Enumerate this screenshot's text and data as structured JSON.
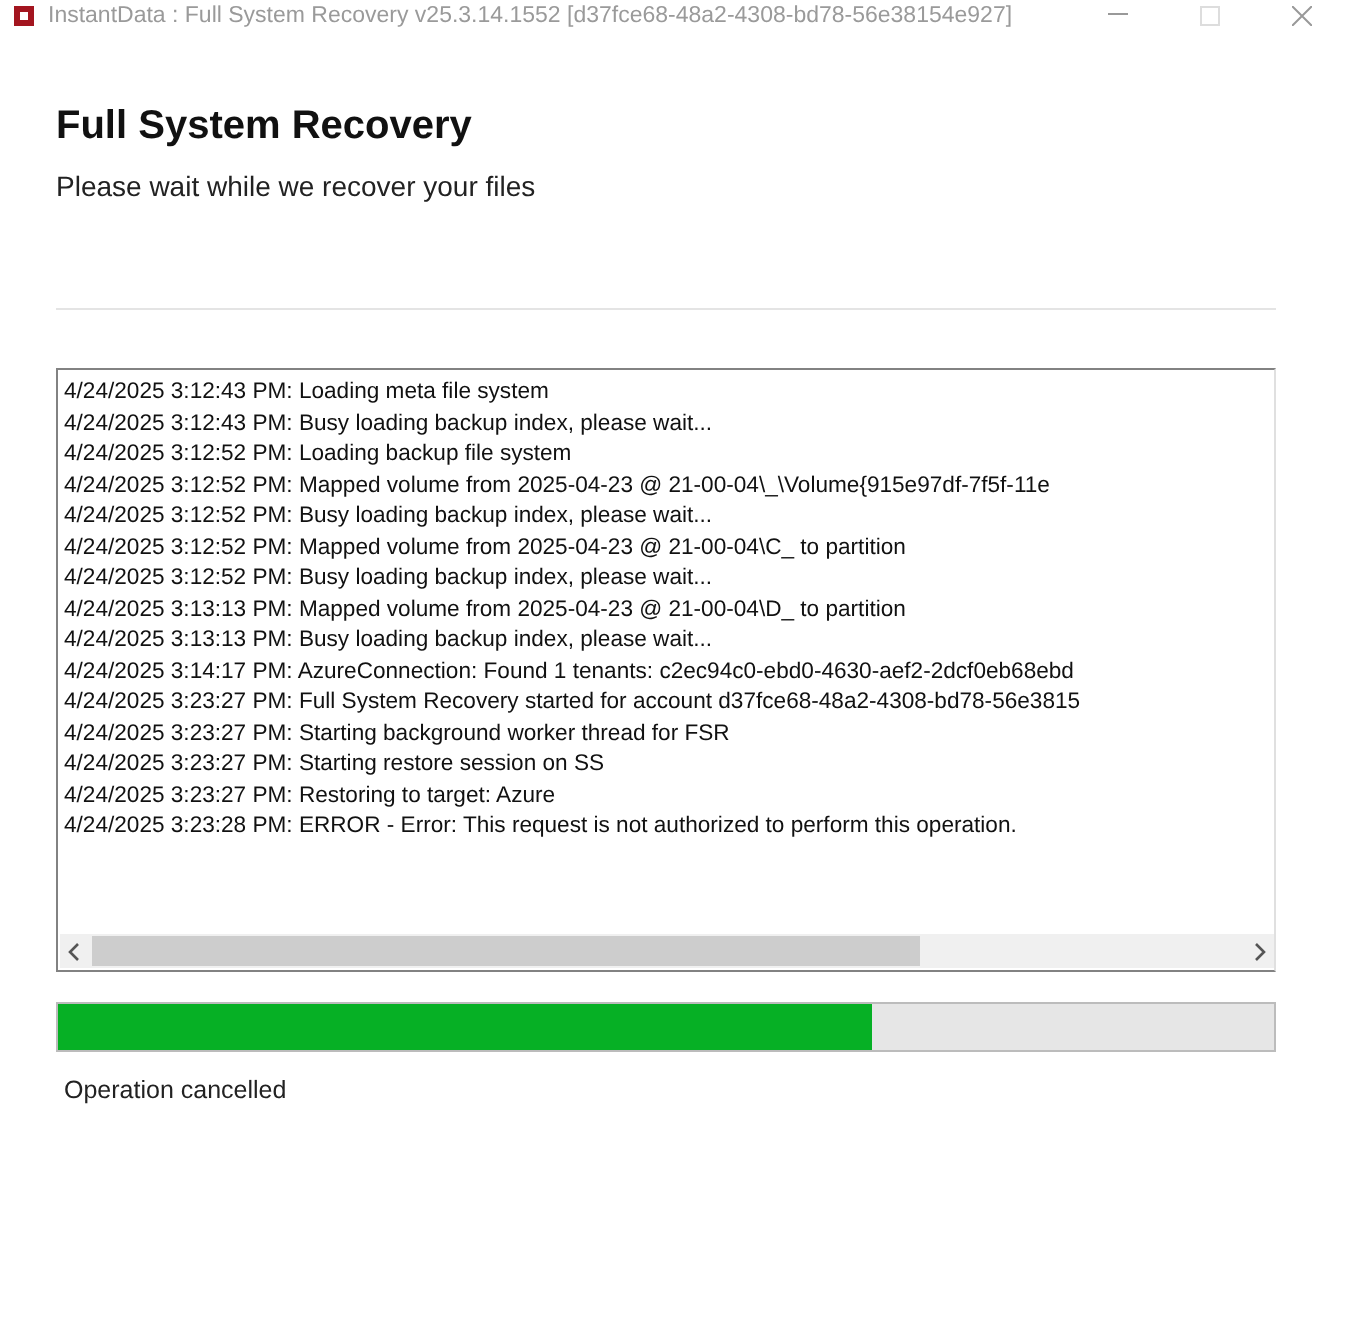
{
  "window": {
    "title": "InstantData : Full System Recovery v25.3.14.1552 [d37fce68-48a2-4308-bd78-56e38154e927]"
  },
  "heading": "Full System Recovery",
  "subtitle": "Please wait while we recover your files",
  "log": [
    "4/24/2025 3:12:43 PM: Loading meta file system",
    "4/24/2025 3:12:43 PM: Busy loading backup index, please wait...",
    "4/24/2025 3:12:52 PM: Loading backup file system",
    "4/24/2025 3:12:52 PM: Mapped volume from 2025-04-23 @ 21-00-04\\_\\Volume{915e97df-7f5f-11e",
    "4/24/2025 3:12:52 PM: Busy loading backup index, please wait...",
    "4/24/2025 3:12:52 PM: Mapped volume from 2025-04-23 @ 21-00-04\\C_ to partition",
    "4/24/2025 3:12:52 PM: Busy loading backup index, please wait...",
    "4/24/2025 3:13:13 PM: Mapped volume from 2025-04-23 @ 21-00-04\\D_ to partition",
    "4/24/2025 3:13:13 PM: Busy loading backup index, please wait...",
    "4/24/2025 3:14:17 PM: AzureConnection: Found 1 tenants: c2ec94c0-ebd0-4630-aef2-2dcf0eb68ebd",
    "4/24/2025 3:23:27 PM: Full System Recovery started for account d37fce68-48a2-4308-bd78-56e3815",
    "4/24/2025 3:23:27 PM: Starting background worker thread for FSR",
    "4/24/2025 3:23:27 PM: Starting restore session on SS",
    "4/24/2025 3:23:27 PM: Restoring to target: Azure",
    "4/24/2025 3:23:28 PM: ERROR - Error: This request is not authorized to perform this operation."
  ],
  "progress": {
    "level": 0.67
  },
  "status": "Operation cancelled"
}
